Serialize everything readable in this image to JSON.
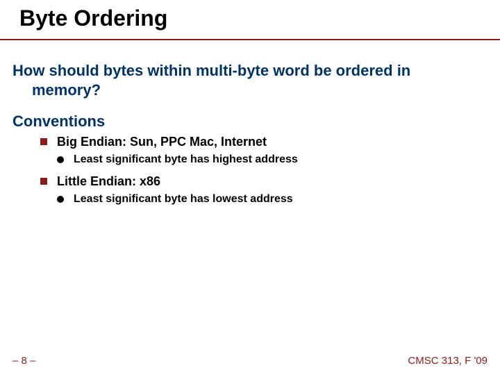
{
  "title": "Byte Ordering",
  "question_line1": "How should bytes within multi-byte word be ordered in",
  "question_line2": "memory?",
  "section1": "Conventions",
  "bullets": {
    "b1": "Big Endian: Sun, PPC Mac, Internet",
    "b1_sub": "Least significant byte has highest address",
    "b2": "Little Endian: x86",
    "b2_sub": "Least significant byte has lowest address"
  },
  "footer_left": "– 8 –",
  "footer_right": "CMSC 313, F '09",
  "colors": {
    "accent": "#8b1a1a",
    "heading": "#003366"
  }
}
